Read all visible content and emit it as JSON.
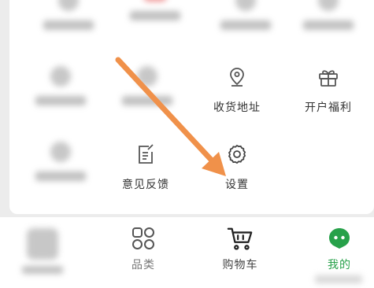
{
  "grid": {
    "items": [
      {
        "label": "收货地址",
        "icon": "location-pin-icon"
      },
      {
        "label": "开户福利",
        "icon": "gift-icon"
      },
      {
        "label": "意见反馈",
        "icon": "edit-note-icon"
      },
      {
        "label": "设置",
        "icon": "gear-icon"
      }
    ]
  },
  "tabbar": {
    "tabs": [
      {
        "label": "品类",
        "icon": "category-grid-icon"
      },
      {
        "label": "购物车",
        "icon": "shopping-cart-icon"
      },
      {
        "label": "我的",
        "icon": "profile-face-icon",
        "active": true
      }
    ]
  },
  "colors": {
    "accent": "#27a14a",
    "arrow": "#f0914a",
    "text": "#333333"
  }
}
